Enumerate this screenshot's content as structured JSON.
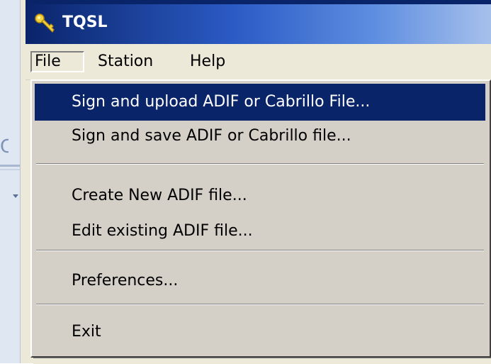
{
  "window": {
    "title": "TQSL",
    "icon": "key-icon"
  },
  "menubar": {
    "items": [
      {
        "label": "File",
        "state": "open"
      },
      {
        "label": "Station"
      },
      {
        "label": "Help"
      }
    ]
  },
  "file_menu": {
    "items": [
      {
        "label": "Sign and upload ADIF or Cabrillo File...",
        "highlighted": true
      },
      {
        "label": "Sign and save ADIF or Cabrillo file..."
      },
      {
        "label": "Create New ADIF file..."
      },
      {
        "label": "Edit existing ADIF file..."
      },
      {
        "label": "Preferences..."
      },
      {
        "label": "Exit"
      }
    ]
  },
  "colors": {
    "title_bar": "#0a246a",
    "menu_highlight": "#0a246a",
    "menu_background": "#d4d0c8"
  }
}
